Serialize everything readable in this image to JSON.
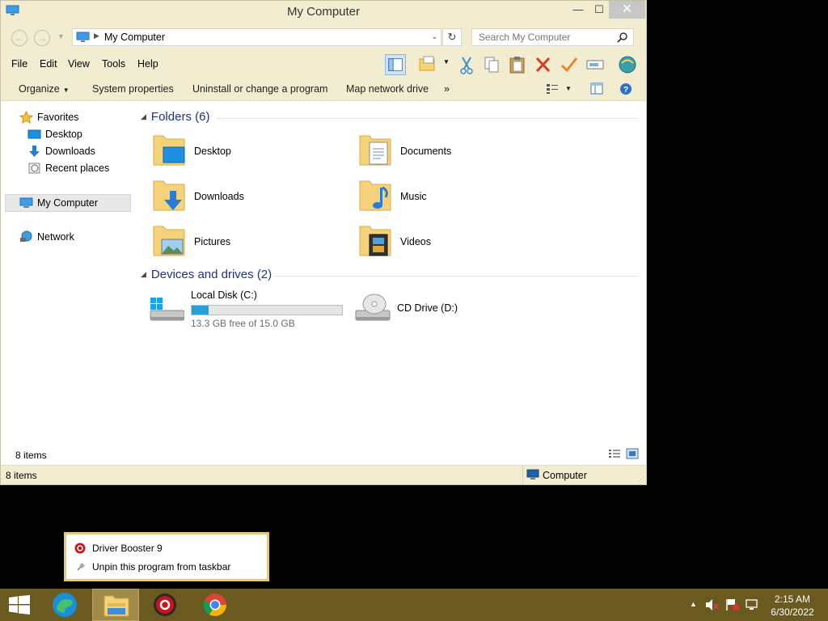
{
  "window": {
    "title": "My Computer",
    "controls": {
      "minimize": "—",
      "maximize": "☐",
      "close": "✕"
    }
  },
  "address": {
    "path": "My Computer",
    "search_placeholder": "Search My Computer"
  },
  "menu": [
    "File",
    "Edit",
    "View",
    "Tools",
    "Help"
  ],
  "commands": {
    "organize": "Organize",
    "system_properties": "System properties",
    "uninstall": "Uninstall or change a program",
    "map_drive": "Map network drive",
    "more": "»"
  },
  "navpane": {
    "favorites": "Favorites",
    "desktop": "Desktop",
    "downloads": "Downloads",
    "recent": "Recent places",
    "my_computer": "My Computer",
    "network": "Network"
  },
  "folders_header": "Folders (6)",
  "folders": [
    {
      "name": "Desktop",
      "icon": "desktop-folder-icon"
    },
    {
      "name": "Documents",
      "icon": "documents-folder-icon"
    },
    {
      "name": "Downloads",
      "icon": "downloads-folder-icon"
    },
    {
      "name": "Music",
      "icon": "music-folder-icon"
    },
    {
      "name": "Pictures",
      "icon": "pictures-folder-icon"
    },
    {
      "name": "Videos",
      "icon": "videos-folder-icon"
    }
  ],
  "drives_header": "Devices and drives (2)",
  "drives": {
    "c": {
      "name": "Local Disk (C:)",
      "free": "13.3 GB free of 15.0 GB",
      "used_fraction": 0.113
    },
    "d": {
      "name": "CD Drive (D:)"
    }
  },
  "content_count": "8 items",
  "status": {
    "count": "8 items",
    "location": "Computer"
  },
  "jumplist": {
    "app": "Driver Booster 9",
    "unpin": "Unpin this program from taskbar"
  },
  "tray": {
    "time": "2:15 AM",
    "date": "6/30/2022"
  },
  "colors": {
    "chrome": "#f2ecd0",
    "taskbar": "#6b5a20",
    "link_blue": "#1e3287",
    "progress": "#26a0da"
  }
}
